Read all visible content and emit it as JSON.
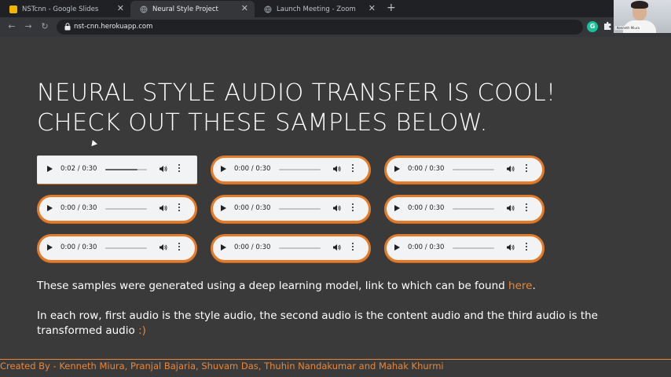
{
  "browser": {
    "tabs": [
      {
        "title": "NSTcnn - Google Slides",
        "icon": "google-slides-icon",
        "active": false
      },
      {
        "title": "Neural Style Project",
        "icon": "globe-icon",
        "active": true
      },
      {
        "title": "Launch Meeting - Zoom",
        "icon": "globe-icon",
        "active": false
      }
    ],
    "url": "nst-cnn.herokuapp.com",
    "extension_letter": "G",
    "webcam_name": "Kenneth Miura"
  },
  "page": {
    "headline_line1": "NEURAL STYLE AUDIO TRANSFER IS COOL!",
    "headline_line2": "CHECK OUT THESE SAMPLES BELOW.",
    "players": [
      {
        "time": "0:02 / 0:30",
        "progress": 0.78,
        "focused": true
      },
      {
        "time": "0:00 / 0:30",
        "progress": 0
      },
      {
        "time": "0:00 / 0:30",
        "progress": 0
      },
      {
        "time": "0:00 / 0:30",
        "progress": 0
      },
      {
        "time": "0:00 / 0:30",
        "progress": 0
      },
      {
        "time": "0:00 / 0:30",
        "progress": 0
      },
      {
        "time": "0:00 / 0:30",
        "progress": 0
      },
      {
        "time": "0:00 / 0:30",
        "progress": 0
      },
      {
        "time": "0:00 / 0:30",
        "progress": 0
      }
    ],
    "para1_text": "These samples were generated using a deep learning model, link to which can be found ",
    "para1_link": "here",
    "para1_end": ".",
    "para2_text": "In each row, first audio is the style audio, the second audio is the content audio and the third audio is the transformed audio ",
    "para2_smile": ":)",
    "footer": "Created By - Kenneth Miura, Pranjal Bajaria, Shuvam Das, Thuhin Nandakumar and Mahak Khurmi"
  },
  "colors": {
    "background": "#3a3a3a",
    "accent": "#e8863b"
  }
}
